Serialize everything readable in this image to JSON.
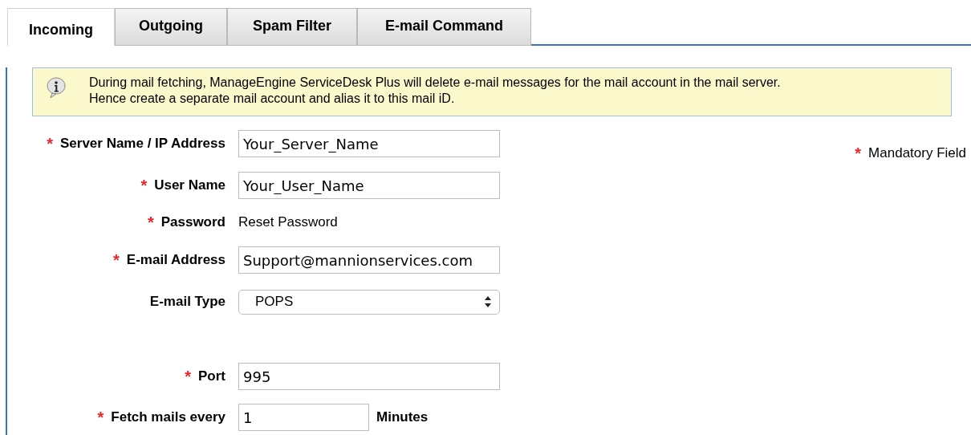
{
  "tabs": [
    {
      "label": "Incoming",
      "selected": true
    },
    {
      "label": "Outgoing",
      "selected": false
    },
    {
      "label": "Spam Filter",
      "selected": false
    },
    {
      "label": "E-mail Command",
      "selected": false
    }
  ],
  "info": {
    "lines": [
      "During mail fetching, ManageEngine ServiceDesk Plus will delete e-mail messages for the mail account in the mail server.",
      "Hence create a separate mail account and alias it to this mail iD."
    ]
  },
  "legend": {
    "mark": "*",
    "label": "Mandatory Field"
  },
  "fields": [
    {
      "kind": "input",
      "mark": "*",
      "label": "Server Name / IP Address",
      "value": "Your_Server_Name"
    },
    {
      "kind": "input",
      "mark": "*",
      "label": "User Name",
      "value": "Your_User_Name"
    },
    {
      "kind": "text",
      "mark": "*",
      "label": "Password",
      "value": "Reset Password"
    },
    {
      "kind": "input",
      "mark": "*",
      "label": "E-mail Address",
      "value": "Support@mannionservices.com"
    },
    {
      "kind": "select",
      "label": "E-mail Type",
      "value": "POPS"
    },
    {
      "kind": "input",
      "mark": "*",
      "label": "Port",
      "value": "995"
    },
    {
      "kind": "short_input",
      "mark": "*",
      "label": "Fetch mails every",
      "value": "1",
      "unit": "Minutes"
    }
  ]
}
